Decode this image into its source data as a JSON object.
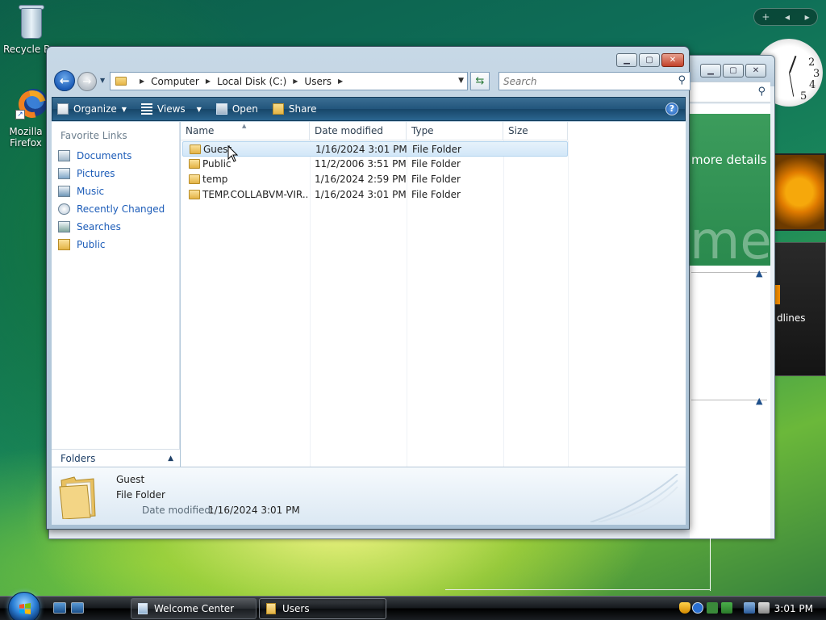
{
  "desktop": {
    "icons": [
      {
        "label": "Recycle Bin",
        "icon": "recycle-bin-icon"
      },
      {
        "label": "Mozilla Firefox",
        "icon": "firefox-icon"
      }
    ]
  },
  "gadgets": {
    "controls": {
      "add": "+",
      "prev": "◂",
      "next": "▸"
    },
    "clock_numbers": {
      "n2": "2",
      "n3": "3",
      "n4": "4",
      "n5": "5"
    },
    "feed_text": "dlines"
  },
  "background_window": {
    "title": "Welcome Center",
    "banner_text": "more details",
    "banner_big": "me"
  },
  "explorer": {
    "breadcrumb": [
      "Computer",
      "Local Disk (C:)",
      "Users"
    ],
    "search_placeholder": "Search",
    "toolbar": {
      "organize": "Organize",
      "views": "Views",
      "open": "Open",
      "share": "Share"
    },
    "nav_pane": {
      "header": "Favorite Links",
      "links": [
        "Documents",
        "Pictures",
        "Music",
        "Recently Changed",
        "Searches",
        "Public"
      ],
      "folders_label": "Folders"
    },
    "columns": [
      "Name",
      "Date modified",
      "Type",
      "Size"
    ],
    "rows": [
      {
        "name": "Guest",
        "date": "1/16/2024 3:01 PM",
        "type": "File Folder",
        "size": ""
      },
      {
        "name": "Public",
        "date": "11/2/2006 3:51 PM",
        "type": "File Folder",
        "size": ""
      },
      {
        "name": "temp",
        "date": "1/16/2024 2:59 PM",
        "type": "File Folder",
        "size": ""
      },
      {
        "name": "TEMP.COLLABVM-VIR...",
        "date": "1/16/2024 3:01 PM",
        "type": "File Folder",
        "size": ""
      }
    ],
    "selected_row": 0,
    "details": {
      "name": "Guest",
      "type": "File Folder",
      "date_label": "Date modified:",
      "date_value": "1/16/2024 3:01 PM"
    }
  },
  "taskbar": {
    "buttons": [
      {
        "label": "Welcome Center",
        "active": false
      },
      {
        "label": "Users",
        "active": true
      }
    ],
    "time": "3:01 PM"
  },
  "colors": {
    "link_blue": "#1c5cb8",
    "command_bar": "#22557c",
    "selection": "#d2e7f8"
  }
}
